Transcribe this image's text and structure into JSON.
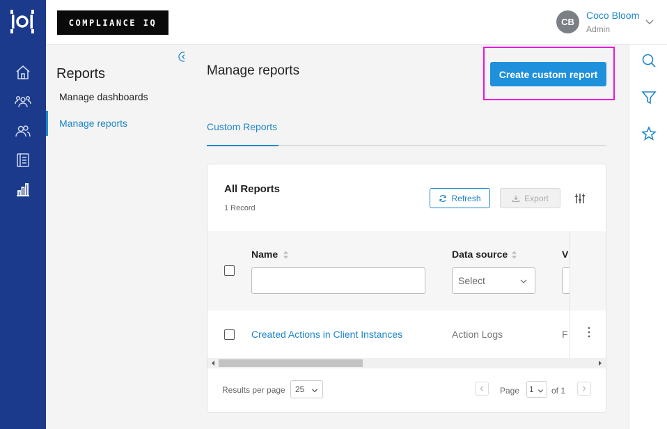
{
  "brand": {
    "logo_text": "COMPLIANCE IQ"
  },
  "user": {
    "initials": "CB",
    "name": "Coco Bloom",
    "role": "Admin"
  },
  "rail_icons": [
    "home-icon",
    "users-icon",
    "groups-icon",
    "notebook-icon",
    "bar-chart-icon"
  ],
  "subnav": {
    "title": "Reports",
    "items": [
      {
        "label": "Manage dashboards",
        "active": false
      },
      {
        "label": "Manage reports",
        "active": true
      }
    ]
  },
  "main": {
    "title": "Manage reports",
    "create_button": "Create custom report",
    "tabs": [
      {
        "label": "Custom Reports",
        "active": true
      }
    ]
  },
  "card": {
    "title": "All Reports",
    "record_count": "1 Record",
    "refresh_label": "Refresh",
    "export_label": "Export",
    "columns": [
      {
        "label": "Name",
        "filter": "text",
        "filter_value": ""
      },
      {
        "label": "Data source",
        "filter": "select",
        "filter_value": "Select"
      },
      {
        "label": "V",
        "filter": "text",
        "filter_value": ""
      }
    ],
    "rows": [
      {
        "name": "Created Actions in Client Instances",
        "data_source": "Action Logs",
        "third": "F"
      }
    ]
  },
  "pagination": {
    "rows_label": "Results per page",
    "rows_value": "25",
    "page_label": "Page",
    "page_value": "1",
    "of_label": "of 1"
  },
  "tool_icons": [
    "search-icon",
    "filter-icon",
    "star-icon"
  ],
  "colors": {
    "rail": "#1b3a8c",
    "accent": "#1e86c8",
    "cta": "#1e90dc",
    "highlight": "#ee11dd"
  }
}
